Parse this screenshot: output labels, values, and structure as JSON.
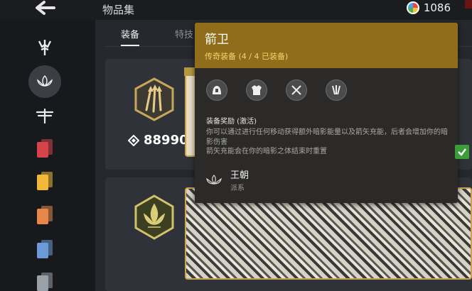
{
  "header": {
    "title": "物品集",
    "currency": {
      "icon": "color-wheel-icon",
      "amount": "1086"
    }
  },
  "sidebar": {
    "items": [
      {
        "name": "class-trident-icon",
        "active": false
      },
      {
        "name": "lotus-icon",
        "active": true
      },
      {
        "name": "dragonfly-icon",
        "active": false
      },
      {
        "name": "card-stack-red-icon",
        "color": "#d4444a"
      },
      {
        "name": "card-stack-yellow-icon",
        "color": "#f1b83a"
      },
      {
        "name": "card-stack-orange-icon",
        "color": "#e6884a"
      },
      {
        "name": "card-stack-blue-icon",
        "color": "#6b9ad6"
      },
      {
        "name": "card-stack-gray-icon",
        "color": "#9aa0a8"
      }
    ]
  },
  "tabs": [
    {
      "label": "装备",
      "active": true
    },
    {
      "label": "特技",
      "active": false
    }
  ],
  "sets": [
    {
      "badge_icon": "arrows-hex-icon",
      "score": "88990"
    },
    {
      "badge_icon": "fleur-hex-icon"
    }
  ],
  "tooltip": {
    "name": "箭卫",
    "rarity": "传奇装备 (4 / 4 已装备)",
    "pieces": [
      "helmet-icon",
      "chest-armor-icon",
      "crossed-swords-icon",
      "arrows-icon"
    ],
    "bonus_title": "装备奖励 (激活)",
    "bonus_lines": [
      "你可以通过进行任何移动获得额外暗影能量以及箭矢充能，后者会增加你的暗影伤害",
      "箭矢充能会在你的暗影之体结束时重置"
    ],
    "faction_name": "王朝",
    "faction_type": "派系"
  },
  "colors": {
    "accent_gold": "#8f6d1a",
    "rarity_text": "#f6d370",
    "slot_border": "#c9a44a"
  }
}
